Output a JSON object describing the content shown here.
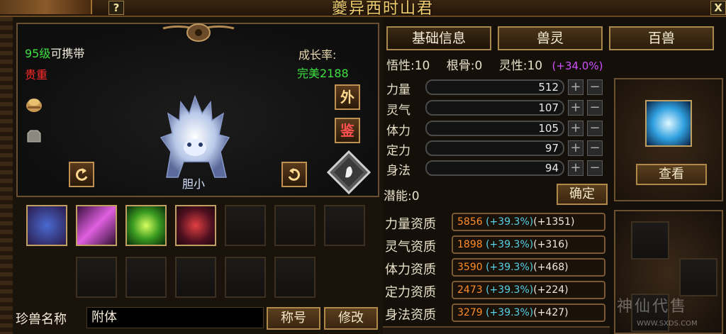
{
  "window": {
    "title": "夔异西时山君",
    "help_label": "?",
    "close_label": "X"
  },
  "pet": {
    "level_text": "95级",
    "carry_text": "可携带",
    "rarity": "贵重",
    "growth_label": "成长率:",
    "growth_value": "完美2188",
    "personality": "胆小",
    "side_btn_out": "外",
    "side_btn_appraise": "鉴"
  },
  "name_row": {
    "label": "珍兽名称",
    "value": "附体",
    "title_btn": "称号",
    "edit_btn": "修改"
  },
  "tabs": [
    "基础信息",
    "兽灵",
    "百兽"
  ],
  "attrs": {
    "wuxing_label": "悟性:",
    "wuxing": "10",
    "gengu_label": "根骨:",
    "gengu": "0",
    "lingxing_label": "灵性:",
    "lingxing": "10",
    "lingxing_bonus": "(+34.0%)"
  },
  "stats": [
    {
      "label": "力量",
      "value": "512"
    },
    {
      "label": "灵气",
      "value": "107"
    },
    {
      "label": "体力",
      "value": "105"
    },
    {
      "label": "定力",
      "value": "97"
    },
    {
      "label": "身法",
      "value": "94"
    }
  ],
  "potential": {
    "label": "潜能:",
    "value": "0",
    "confirm": "确定"
  },
  "qualities": [
    {
      "label": "力量资质",
      "base": "5856",
      "pct": "(+39.3%)",
      "bonus": "(+1351)"
    },
    {
      "label": "灵气资质",
      "base": "1898",
      "pct": "(+39.3%)",
      "bonus": "(+316)"
    },
    {
      "label": "体力资质",
      "base": "3590",
      "pct": "(+39.3%)",
      "bonus": "(+468)"
    },
    {
      "label": "定力资质",
      "base": "2473",
      "pct": "(+39.3%)",
      "bonus": "(+224)"
    },
    {
      "label": "身法资质",
      "base": "3279",
      "pct": "(+39.3%)",
      "bonus": "(+427)"
    }
  ],
  "view_btn": "查看",
  "watermark": {
    "name": "神仙代售",
    "url": "WWW.SXDS.COM"
  },
  "colors": {
    "green": "#3ee040",
    "red": "#ff2a2a",
    "gold": "#f0d070",
    "purple": "#d050ff"
  }
}
